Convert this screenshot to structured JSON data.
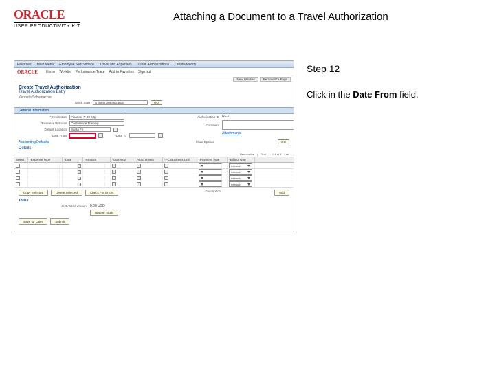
{
  "brand": {
    "logo": "ORACLE",
    "sub": "USER PRODUCTIVITY KIT"
  },
  "page_title": "Attaching a Document to a Travel Authorization",
  "instruction": {
    "step": "Step 12",
    "text_pre": "Click in the ",
    "bold": "Date From",
    "text_post": " field."
  },
  "shot": {
    "topnav": {
      "items": [
        "Favorites",
        "Main Menu",
        "Employee Self-Service",
        "Travel and Expenses",
        "Travel Authorizations",
        "Create/Modify"
      ]
    },
    "brand": "ORACLE",
    "links": [
      "Home",
      "Worklist",
      "Performance Trace",
      "Add to Favorites",
      "Sign out"
    ],
    "tabs": [
      "New Window",
      "Personalize Page"
    ],
    "h1": "Create Travel Authorization",
    "h2": "Travel Authorization Entry",
    "name": "Kenneth Schumacher",
    "quick_start": {
      "label": "Quick Start",
      "value": "A Blank Authorization",
      "go": "GO"
    },
    "section_general": "General Information",
    "left_fields": {
      "desc": {
        "label": "*Description",
        "value": "Finance: P-20 Mtg"
      },
      "biz_purpose": {
        "label": "*Business Purpose",
        "value": "Conference Training"
      },
      "default_loc": {
        "label": "Default Location",
        "value": "Santa Fe"
      },
      "date_from": {
        "label": "Date From",
        "value": ""
      },
      "date_to": {
        "label": "*Date To",
        "value": ""
      }
    },
    "right_fields": {
      "auth_id": {
        "label": "Authorization ID",
        "value": "NEXT"
      },
      "comment": {
        "label": "Comment",
        "value": ""
      },
      "attachments": "Attachments"
    },
    "acct_defaults": "Accounting Defaults",
    "more_options": {
      "label": "More Options",
      "value": "",
      "go": "GO"
    },
    "details": "Details",
    "nav": {
      "pc": "Personalize",
      "find": "Find",
      "count": "1-4 of 4",
      "last": "Last"
    },
    "table": {
      "headers": [
        "Select",
        "*Expense Type",
        "*Date",
        "*Amount",
        "*Currency",
        "Attachments",
        "*PC Business Unit",
        "*Payment Type",
        "*Billing Type"
      ],
      "billing_value": "Internal",
      "rows": 4
    },
    "btns1": [
      "Copy Selected",
      "Delete Selected",
      "Check For Errors"
    ],
    "desc2_label": "Description",
    "add_btn": "Add",
    "totals": "Totals",
    "auth_amt": {
      "label": "Authorized Amount",
      "value": "0.00  USD"
    },
    "update_totals": "Update Totals",
    "btns2": [
      "Save for Later",
      "Submit"
    ]
  }
}
